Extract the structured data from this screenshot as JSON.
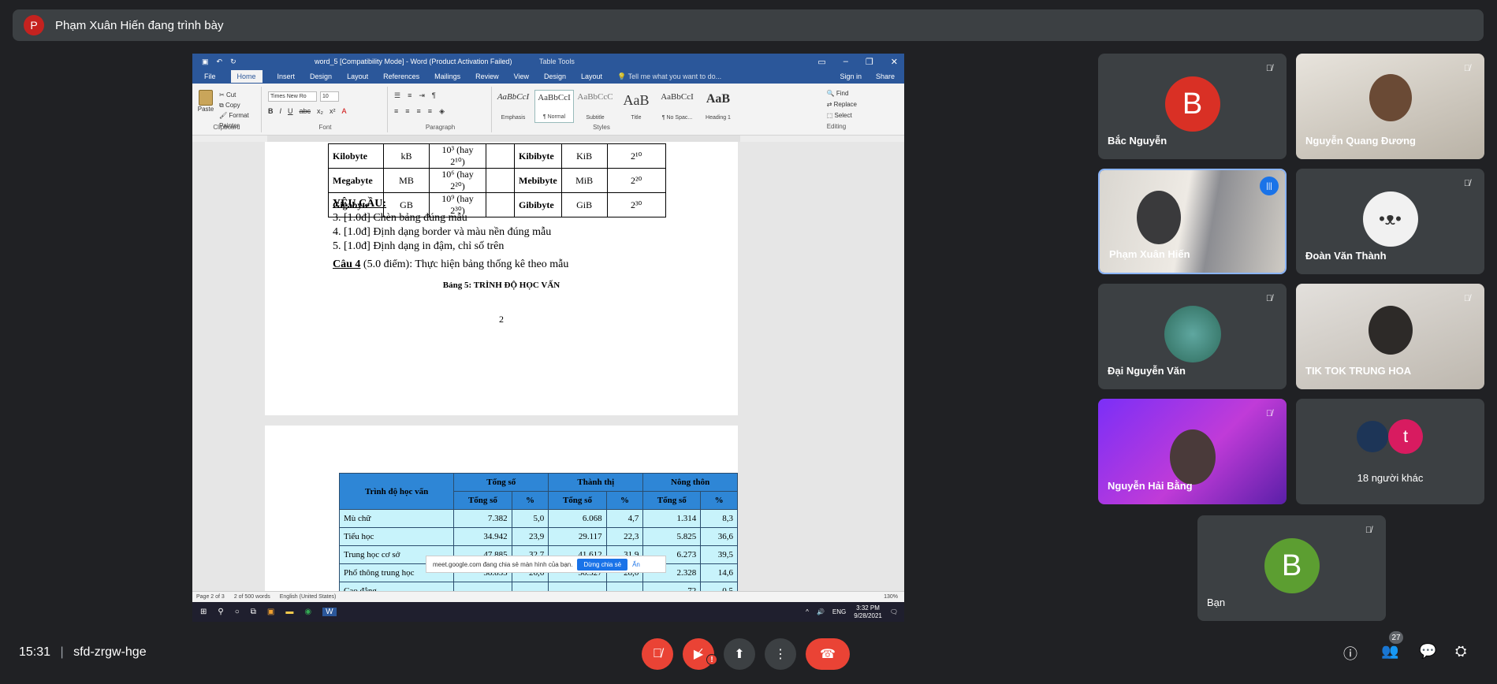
{
  "presenter_banner": {
    "avatar_letter": "P",
    "text": "Phạm Xuân Hiến đang trình bày"
  },
  "word": {
    "doc_title": "word_5 [Compatibility Mode] - Word (Product Activation Failed)",
    "table_tools": "Table Tools",
    "tabs": [
      "File",
      "Home",
      "Insert",
      "Design",
      "Layout",
      "References",
      "Mailings",
      "Review",
      "View",
      "Design",
      "Layout"
    ],
    "tell_me": "Tell me what you want to do...",
    "sign_in": "Sign in",
    "share": "Share",
    "clipboard": {
      "paste": "Paste",
      "cut": "Cut",
      "copy": "Copy",
      "format_painter": "Format Painter",
      "group": "Clipboard"
    },
    "font": {
      "name": "Times New Ro",
      "size": "10",
      "group": "Font"
    },
    "paragraph_group": "Paragraph",
    "styles_group": "Styles",
    "styles": [
      {
        "preview": "AaBbCcI",
        "name": "Emphasis"
      },
      {
        "preview": "AaBbCcI",
        "name": "¶ Normal"
      },
      {
        "preview": "AaBbCcC",
        "name": "Subtitle"
      },
      {
        "preview": "AaB",
        "name": "Title"
      },
      {
        "preview": "AaBbCcI",
        "name": "¶ No Spac..."
      },
      {
        "preview": "AaB",
        "name": "Heading 1"
      }
    ],
    "editing": {
      "find": "Find",
      "replace": "Replace",
      "select": "Select",
      "group": "Editing"
    },
    "unit_table": [
      [
        "Kilobyte",
        "kB",
        "10³ (hay 2¹⁰)",
        "",
        "Kibibyte",
        "KiB",
        "2¹⁰"
      ],
      [
        "Megabyte",
        "MB",
        "10⁶ (hay 2²⁰)",
        "",
        "Mebibyte",
        "MiB",
        "2²⁰"
      ],
      [
        "Gigabyte",
        "GB",
        "10⁹ (hay 2³⁰)",
        "",
        "Gibibyte",
        "GiB",
        "2³⁰"
      ]
    ],
    "requirements": {
      "heading": "YÊU CẦU:",
      "items": [
        "3.   [1.0đ]  Chèn bảng đúng mẫu",
        "4.   [1.0đ]  Định dạng border và màu nền đúng mẫu",
        "5.   [1.0đ]  Định dạng in đậm, chỉ số trên"
      ]
    },
    "question4": {
      "label": "Câu 4",
      "rest": " (5.0 điểm):  Thực hiện bảng thống kê theo mẫu"
    },
    "table_caption": "Bảng 5: TRÌNH ĐỘ HỌC VẤN",
    "page_number": "2",
    "edu_table": {
      "head1": [
        "Trình độ học vấn",
        "Tổng số",
        "Thành thị",
        "Nông thôn"
      ],
      "head2": [
        "Tổng số",
        "%",
        "Tổng số",
        "%",
        "Tổng số",
        "%"
      ],
      "rows": [
        [
          "Mù chữ",
          "7.382",
          "5,0",
          "6.068",
          "4,7",
          "1.314",
          "8,3"
        ],
        [
          "Tiểu học",
          "34.942",
          "23,9",
          "29.117",
          "22,3",
          "5.825",
          "36,6"
        ],
        [
          "Trung học cơ sở",
          "47.885",
          "32,7",
          "41.612",
          "31,9",
          "6.273",
          "39,5"
        ],
        [
          "Phổ thông trung học",
          "38.855",
          "26,6",
          "36.527",
          "28,0",
          "2.328",
          "14,6"
        ],
        [
          "Cao đẳng",
          "",
          "",
          "",
          "",
          "72",
          "0,5"
        ]
      ]
    },
    "share_notice": {
      "text": "meet.google.com đang chia sẻ màn hình của bạn.",
      "stop": "Dừng chia sẻ",
      "hide": "Ẩn"
    },
    "status": {
      "page": "Page 2 of 3",
      "words": "2 of 500 words",
      "lang": "English (United States)",
      "zoom": "130%"
    },
    "taskbar": {
      "lang": "ENG",
      "time": "3:32 PM",
      "date": "9/28/2021"
    }
  },
  "participants": [
    {
      "name": "Bắc Nguyễn",
      "letter": "B",
      "color": "#d93025"
    },
    {
      "name": "Nguyễn Quang Đương"
    },
    {
      "name": "Phạm Xuân Hiến"
    },
    {
      "name": "Đoàn Văn Thành"
    },
    {
      "name": "Đại Nguyễn Văn"
    },
    {
      "name": "TIK TOK TRUNG HOA"
    },
    {
      "name": "Nguyễn Hải Bằng"
    },
    {
      "name": "18 người khác",
      "letters": [
        "",
        "t"
      ]
    },
    {
      "name": "Bạn",
      "letter": "B",
      "color": "#5c9e31"
    }
  ],
  "bottom": {
    "time": "15:31",
    "separator": "|",
    "meeting_code": "sfd-zrgw-hge",
    "people_count": "27"
  }
}
